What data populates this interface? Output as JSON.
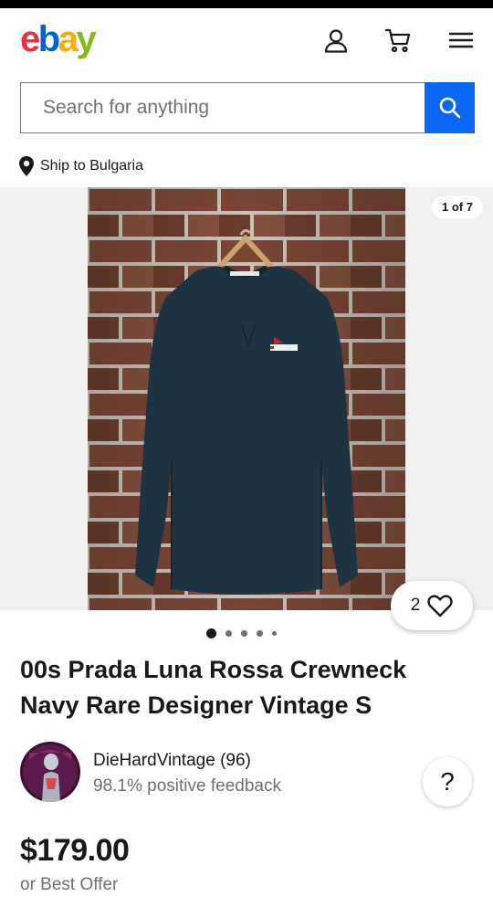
{
  "header": {
    "logo": {
      "letters": [
        "e",
        "b",
        "a",
        "y"
      ],
      "colors": [
        "#e53238",
        "#0064d2",
        "#f5af02",
        "#86b817"
      ]
    },
    "icons": [
      "account-icon",
      "cart-icon",
      "menu-icon"
    ]
  },
  "search": {
    "placeholder": "Search for anything",
    "button_icon": "search-icon",
    "button_color": "#0968f6"
  },
  "shipping": {
    "label": "Ship to Bulgaria",
    "icon": "location-pin-icon"
  },
  "gallery": {
    "counter": "1 of 7",
    "watch_count": "2",
    "watch_icon": "heart-icon",
    "active_index": 1,
    "dot_count": 5
  },
  "listing": {
    "title": "00s Prada Luna Rossa Crewneck Navy Rare Designer Vintage S"
  },
  "seller": {
    "name": "DieHardVintage (96)",
    "feedback": "98.1% positive feedback",
    "help_label": "?"
  },
  "pricing": {
    "price": "$179.00",
    "offer": "or Best Offer"
  }
}
